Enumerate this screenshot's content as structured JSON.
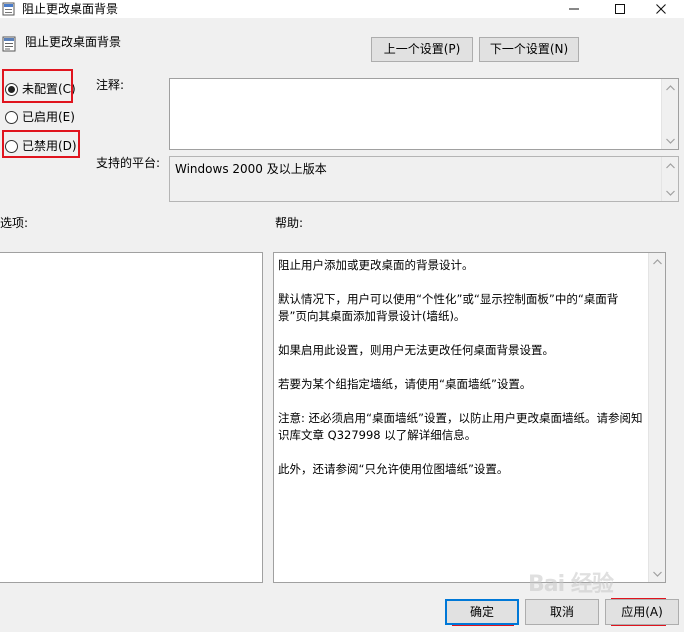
{
  "window": {
    "title": "阻止更改桌面背景",
    "minimize_glyph": "—",
    "maximize_glyph": "☐",
    "close_glyph": "✕"
  },
  "header": {
    "policy_title": "阻止更改桌面背景",
    "prev_button": "上一个设置(P)",
    "next_button": "下一个设置(N)"
  },
  "state": {
    "options": [
      {
        "label": "未配置(C)",
        "checked": true
      },
      {
        "label": "已启用(E)",
        "checked": false
      },
      {
        "label": "已禁用(D)",
        "checked": false
      }
    ]
  },
  "comment": {
    "label": "注释:",
    "value": ""
  },
  "platform": {
    "label": "支持的平台:",
    "value": "Windows 2000 及以上版本"
  },
  "options_section": {
    "label": "选项:"
  },
  "help_section": {
    "label": "帮助:",
    "paragraphs": [
      "阻止用户添加或更改桌面的背景设计。",
      "默认情况下，用户可以使用“个性化”或“显示控制面板”中的“桌面背景”页向其桌面添加背景设计(墙纸)。",
      "如果启用此设置，则用户无法更改任何桌面背景设置。",
      "若要为某个组指定墙纸，请使用“桌面墙纸”设置。",
      "注意: 还必须启用“桌面墙纸”设置，以防止用户更改桌面墙纸。请参阅知识库文章 Q327998 以了解详细信息。",
      "此外，还请参阅“只允许使用位图墙纸”设置。"
    ]
  },
  "footer": {
    "ok_button": "确定",
    "cancel_button": "取消",
    "apply_button": "应用(A)"
  },
  "watermark": "Bai 经验",
  "colors": {
    "highlight_red": "#e0141e",
    "window_bg": "#f0f0f0",
    "accent_blue": "#0078d7"
  }
}
